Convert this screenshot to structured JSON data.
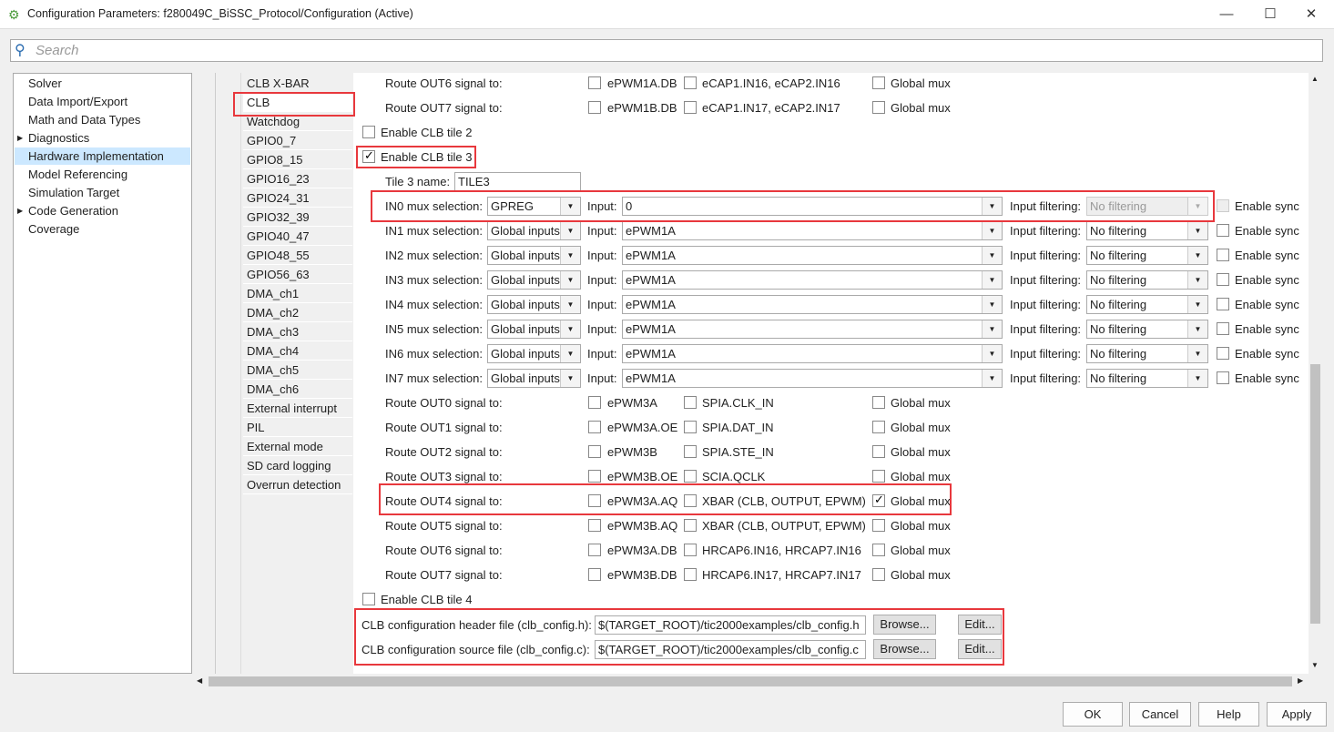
{
  "window": {
    "title": "Configuration Parameters: f280049C_BiSSC_Protocol/Configuration (Active)",
    "minimize": "—",
    "maximize": "☐",
    "close": "✕"
  },
  "search": {
    "placeholder": "Search"
  },
  "tree": [
    "Solver",
    "Data Import/Export",
    "Math and Data Types",
    "Diagnostics",
    "Hardware Implementation",
    "Model Referencing",
    "Simulation Target",
    "Code Generation",
    "Coverage"
  ],
  "subcategories": [
    "CLB X-BAR",
    "CLB",
    "Watchdog",
    "GPIO0_7",
    "GPIO8_15",
    "GPIO16_23",
    "GPIO24_31",
    "GPIO32_39",
    "GPIO40_47",
    "GPIO48_55",
    "GPIO56_63",
    "DMA_ch1",
    "DMA_ch2",
    "DMA_ch3",
    "DMA_ch4",
    "DMA_ch5",
    "DMA_ch6",
    "External interrupt",
    "PIL",
    "External mode",
    "SD card logging",
    "Overrun detection"
  ],
  "tile2_routes": [
    {
      "label": "Route OUT6 signal to:",
      "o1": "ePWM1A.DB",
      "o2": "eCAP1.IN16, eCAP2.IN16",
      "o3": "Global mux",
      "c3": false
    },
    {
      "label": "Route OUT7 signal to:",
      "o1": "ePWM1B.DB",
      "o2": "eCAP1.IN17, eCAP2.IN17",
      "o3": "Global mux",
      "c3": false
    }
  ],
  "enable_tile2": {
    "label": "Enable CLB tile 2",
    "checked": false
  },
  "enable_tile3": {
    "label": "Enable CLB tile 3",
    "checked": true
  },
  "tile3_name": {
    "label": "Tile 3 name:",
    "value": "TILE3"
  },
  "mux_rows": [
    {
      "label": "IN0 mux selection:",
      "mux": "GPREG",
      "input_label": "Input:",
      "input": "0",
      "filter_label": "Input filtering:",
      "filter": "No filtering",
      "sync": "Enable sync",
      "disabled": true
    },
    {
      "label": "IN1 mux selection:",
      "mux": "Global inputs",
      "input_label": "Input:",
      "input": "ePWM1A",
      "filter_label": "Input filtering:",
      "filter": "No filtering",
      "sync": "Enable sync"
    },
    {
      "label": "IN2 mux selection:",
      "mux": "Global inputs",
      "input_label": "Input:",
      "input": "ePWM1A",
      "filter_label": "Input filtering:",
      "filter": "No filtering",
      "sync": "Enable sync"
    },
    {
      "label": "IN3 mux selection:",
      "mux": "Global inputs",
      "input_label": "Input:",
      "input": "ePWM1A",
      "filter_label": "Input filtering:",
      "filter": "No filtering",
      "sync": "Enable sync"
    },
    {
      "label": "IN4 mux selection:",
      "mux": "Global inputs",
      "input_label": "Input:",
      "input": "ePWM1A",
      "filter_label": "Input filtering:",
      "filter": "No filtering",
      "sync": "Enable sync"
    },
    {
      "label": "IN5 mux selection:",
      "mux": "Global inputs",
      "input_label": "Input:",
      "input": "ePWM1A",
      "filter_label": "Input filtering:",
      "filter": "No filtering",
      "sync": "Enable sync"
    },
    {
      "label": "IN6 mux selection:",
      "mux": "Global inputs",
      "input_label": "Input:",
      "input": "ePWM1A",
      "filter_label": "Input filtering:",
      "filter": "No filtering",
      "sync": "Enable sync"
    },
    {
      "label": "IN7 mux selection:",
      "mux": "Global inputs",
      "input_label": "Input:",
      "input": "ePWM1A",
      "filter_label": "Input filtering:",
      "filter": "No filtering",
      "sync": "Enable sync"
    }
  ],
  "tile3_routes": [
    {
      "label": "Route OUT0 signal to:",
      "o1": "ePWM3A",
      "o2": "SPIA.CLK_IN",
      "o3": "Global mux",
      "c3": false
    },
    {
      "label": "Route OUT1 signal to:",
      "o1": "ePWM3A.OE",
      "o2": "SPIA.DAT_IN",
      "o3": "Global mux",
      "c3": false
    },
    {
      "label": "Route OUT2 signal to:",
      "o1": "ePWM3B",
      "o2": "SPIA.STE_IN",
      "o3": "Global mux",
      "c3": false
    },
    {
      "label": "Route OUT3 signal to:",
      "o1": "ePWM3B.OE",
      "o2": "SCIA.QCLK",
      "o3": "Global mux",
      "c3": false
    },
    {
      "label": "Route OUT4 signal to:",
      "o1": "ePWM3A.AQ",
      "o2": "XBAR (CLB, OUTPUT, EPWM)",
      "o3": "Global mux",
      "c3": true
    },
    {
      "label": "Route OUT5 signal to:",
      "o1": "ePWM3B.AQ",
      "o2": "XBAR (CLB, OUTPUT, EPWM)",
      "o3": "Global mux",
      "c3": false
    },
    {
      "label": "Route OUT6 signal to:",
      "o1": "ePWM3A.DB",
      "o2": "HRCAP6.IN16, HRCAP7.IN16",
      "o3": "Global mux",
      "c3": false
    },
    {
      "label": "Route OUT7 signal to:",
      "o1": "ePWM3B.DB",
      "o2": "HRCAP6.IN17, HRCAP7.IN17",
      "o3": "Global mux",
      "c3": false
    }
  ],
  "enable_tile4": {
    "label": "Enable CLB tile 4",
    "checked": false
  },
  "files": [
    {
      "label": "CLB configuration header file (clb_config.h):",
      "value": "$(TARGET_ROOT)/tic2000examples/clb_config.h",
      "browse": "Browse...",
      "edit": "Edit..."
    },
    {
      "label": "CLB configuration source file (clb_config.c):",
      "value": "$(TARGET_ROOT)/tic2000examples/clb_config.c",
      "browse": "Browse...",
      "edit": "Edit..."
    }
  ],
  "footer": {
    "ok": "OK",
    "cancel": "Cancel",
    "help": "Help",
    "apply": "Apply"
  },
  "colors": {
    "highlight": "#e8383d",
    "selection": "#cce8ff"
  }
}
